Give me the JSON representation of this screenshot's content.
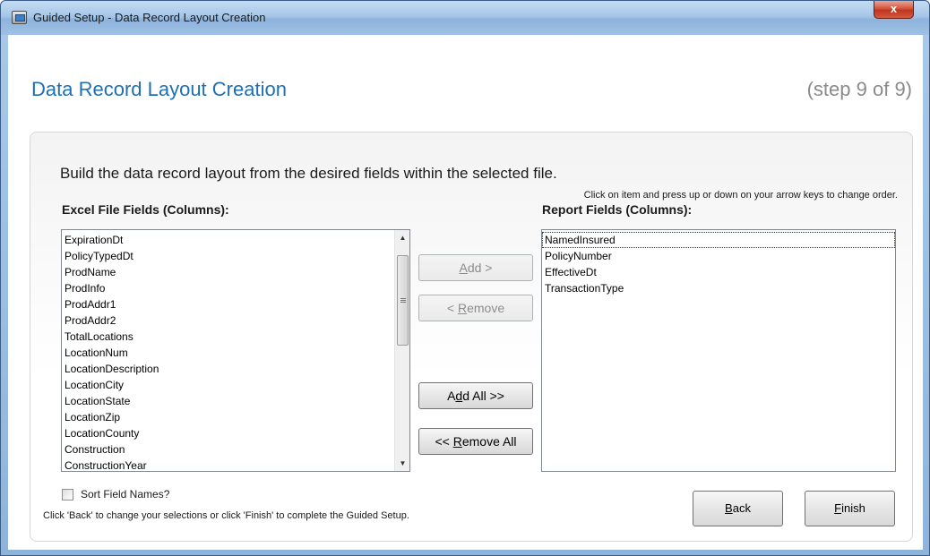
{
  "window": {
    "title": "Guided Setup - Data Record Layout Creation",
    "close_label": "x"
  },
  "header": {
    "title": "Data Record Layout Creation",
    "step": "(step 9 of 9)"
  },
  "panel": {
    "instruction": "Build the data record layout from the desired fields within the selected file.",
    "hint": "Click on item and press up or down on your arrow keys to change order.",
    "left_label": "Excel File Fields (Columns):",
    "right_label": "Report Fields (Columns):",
    "left_items": [
      "ExpirationDt",
      "PolicyTypedDt",
      "ProdName",
      "ProdInfo",
      "ProdAddr1",
      "ProdAddr2",
      "TotalLocations",
      "LocationNum",
      "LocationDescription",
      "LocationCity",
      "LocationState",
      "LocationZip",
      "LocationCounty",
      "Construction",
      "ConstructionYear"
    ],
    "right_items": [
      "NamedInsured",
      "PolicyNumber",
      "EffectiveDt",
      "TransactionType"
    ],
    "buttons": {
      "add": "Add >",
      "remove": "< Remove",
      "add_all": "Add All >>",
      "remove_all": "<< Remove All",
      "back": "Back",
      "finish": "Finish"
    },
    "sort_label": "Sort Field Names?",
    "footer": "Click 'Back' to change your selections or click 'Finish' to complete the Guided Setup."
  },
  "colors": {
    "title_blue": "#1e6fb4",
    "step_gray": "#8a8a8a",
    "close_red": "#c0351e"
  }
}
